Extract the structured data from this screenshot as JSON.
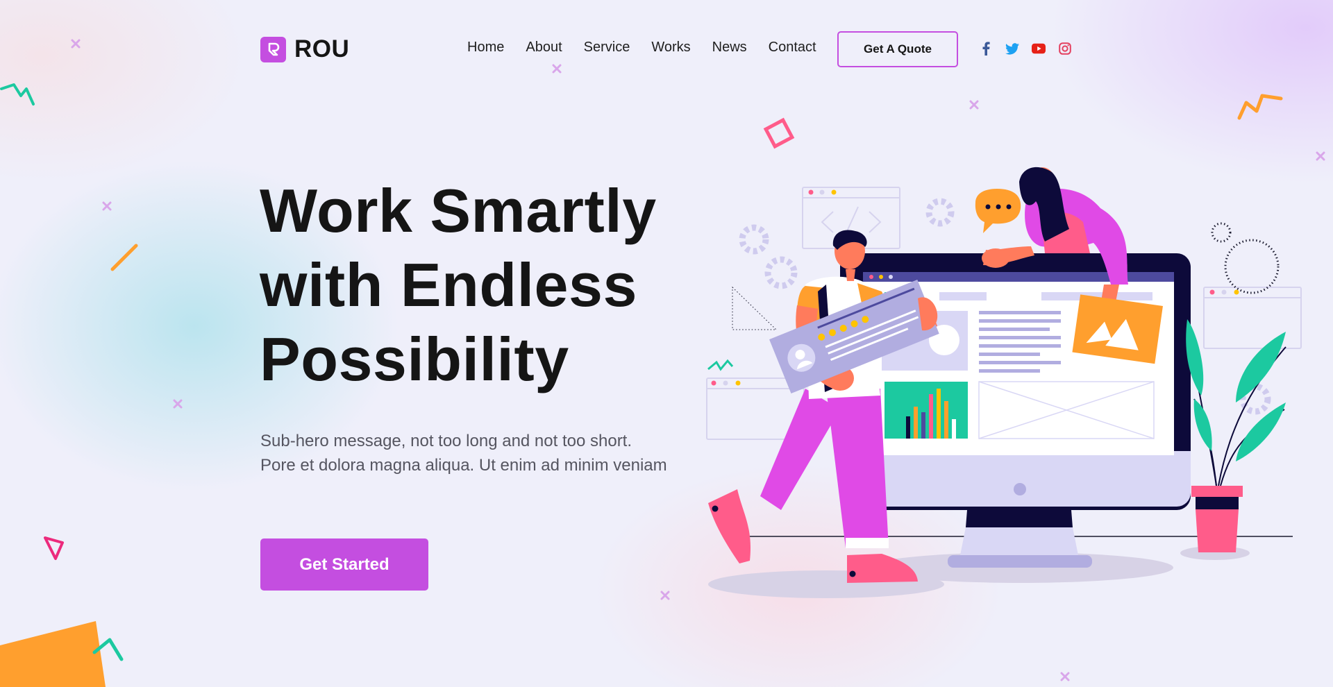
{
  "brand": {
    "name": "ROU",
    "accent": "#c44ee0"
  },
  "nav": {
    "items": [
      {
        "label": "Home"
      },
      {
        "label": "About"
      },
      {
        "label": "Service"
      },
      {
        "label": "Works"
      },
      {
        "label": "News"
      },
      {
        "label": "Contact"
      }
    ],
    "quote_label": "Get A Quote"
  },
  "socials": [
    {
      "icon": "facebook-icon",
      "color": "#3b5998"
    },
    {
      "icon": "twitter-icon",
      "color": "#1da1f2"
    },
    {
      "icon": "youtube-icon",
      "color": "#e62117"
    },
    {
      "icon": "instagram-icon",
      "color": "#e4405f"
    }
  ],
  "hero": {
    "title_lines": [
      "Work Smartly",
      "with Endless",
      "Possibility"
    ],
    "subtitle": "Sub-hero message, not too long and not too short. Pore et dolora magna aliqua. Ut enim ad minim veniam",
    "cta_label": "Get Started"
  },
  "colors": {
    "text": "#151515",
    "muted": "#555560",
    "orange": "#ff9f2e",
    "teal": "#1cc9a0",
    "pink": "#ff5c8a",
    "navy": "#0d0a3a",
    "lavender": "#b1ade0"
  }
}
